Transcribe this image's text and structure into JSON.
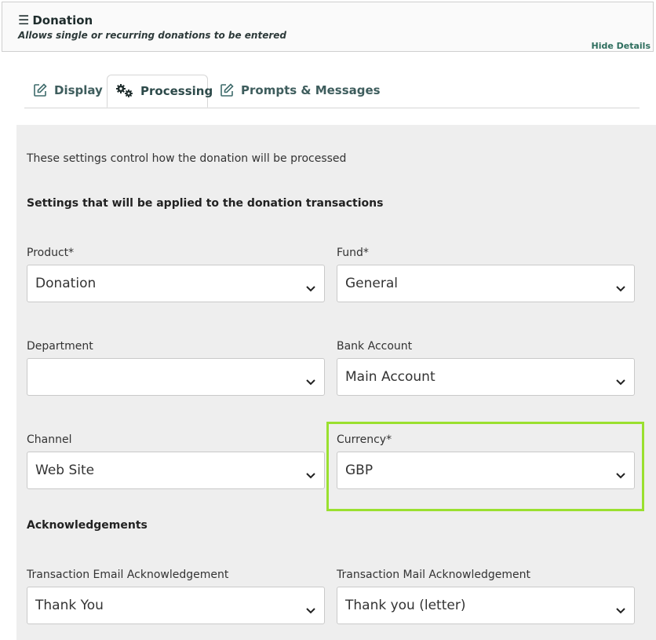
{
  "header": {
    "title": "Donation",
    "subtitle": "Allows single or recurring donations to be entered",
    "hide_details": "Hide Details"
  },
  "tabs": [
    {
      "label": "Display",
      "icon": "edit-icon"
    },
    {
      "label": "Processing",
      "icon": "gears-icon",
      "active": true
    },
    {
      "label": "Prompts & Messages",
      "icon": "edit-icon"
    }
  ],
  "panel": {
    "intro": "These settings control how the donation will be processed",
    "settings_heading": "Settings that will be applied to the donation transactions",
    "acknowledgements_heading": "Acknowledgements"
  },
  "fields": {
    "product": {
      "label": "Product*",
      "value": "Donation"
    },
    "fund": {
      "label": "Fund*",
      "value": "General"
    },
    "department": {
      "label": "Department",
      "value": ""
    },
    "bank_account": {
      "label": "Bank Account",
      "value": "Main Account"
    },
    "channel": {
      "label": "Channel",
      "value": "Web Site"
    },
    "currency": {
      "label": "Currency*",
      "value": "GBP"
    },
    "email_ack": {
      "label": "Transaction Email Acknowledgement",
      "value": "Thank You"
    },
    "mail_ack": {
      "label": "Transaction Mail Acknowledgement",
      "value": "Thank you (letter)"
    }
  },
  "colors": {
    "highlight": "#9ae02f",
    "tab_text": "#3e5d5d",
    "panel_bg": "#eeeeee"
  }
}
